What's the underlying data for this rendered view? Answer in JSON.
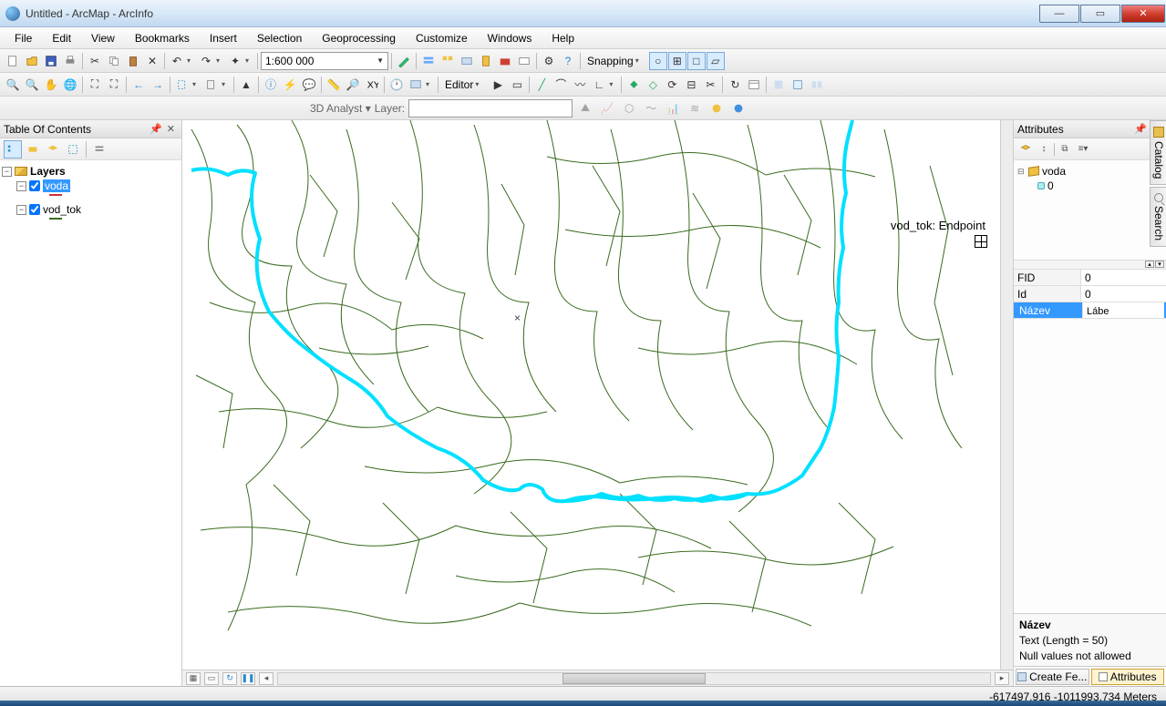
{
  "window": {
    "title": "Untitled - ArcMap - ArcInfo"
  },
  "menu": [
    "File",
    "Edit",
    "View",
    "Bookmarks",
    "Insert",
    "Selection",
    "Geoprocessing",
    "Customize",
    "Windows",
    "Help"
  ],
  "toolbar": {
    "scale": "1:600 000",
    "snapping_label": "Snapping",
    "editor_label": "Editor",
    "analyst_label": "3D Analyst",
    "layer_label": "Layer:"
  },
  "toc": {
    "title": "Table Of Contents",
    "root": "Layers",
    "items": [
      {
        "name": "voda",
        "checked": true,
        "selected": true,
        "symbol": "red"
      },
      {
        "name": "vod_tok",
        "checked": true,
        "selected": false,
        "symbol": "green"
      }
    ]
  },
  "map": {
    "label": "vod_tok: Endpoint"
  },
  "attributes": {
    "title": "Attributes",
    "tree_root": "voda",
    "tree_child": "0",
    "grid": [
      {
        "k": "FID",
        "v": "0",
        "selected": false
      },
      {
        "k": "Id",
        "v": "0",
        "selected": false
      },
      {
        "k": "Název",
        "v": "Lábe",
        "selected": true
      }
    ],
    "info": {
      "name": "Název",
      "type_line": "Text (Length = 50)",
      "null_line": "Null values not allowed"
    },
    "footer": {
      "create": "Create Fe...",
      "attrs": "Attributes"
    }
  },
  "side_tabs": [
    "Catalog",
    "Search"
  ],
  "status": {
    "coords": "-617497,916 -1011993,734 Meters"
  }
}
